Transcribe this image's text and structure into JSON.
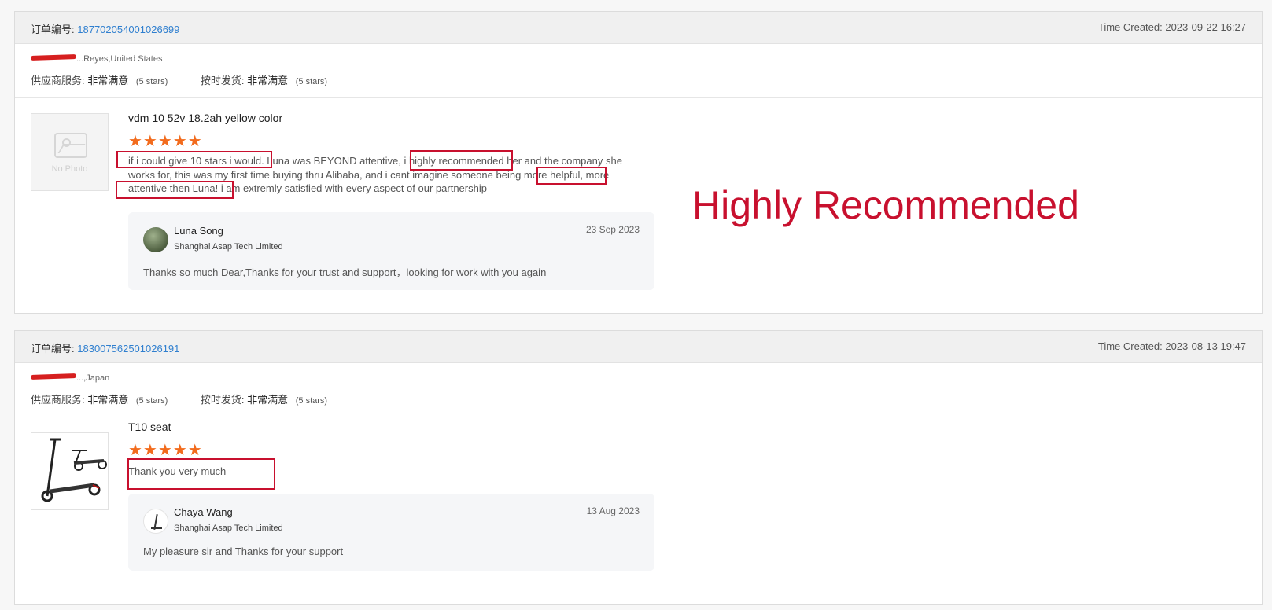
{
  "orders": [
    {
      "order_label": "订单编号:",
      "order_number": "187702054001026699",
      "time_created": "Time Created: 2023-09-22 16:27",
      "location": "...Reyes,United States",
      "supplier_service_label": "供应商服务:",
      "supplier_service_value": "非常满意",
      "supplier_service_stars": "(5 stars)",
      "on_time_label": "按时发货:",
      "on_time_value": "非常满意",
      "on_time_stars": "(5 stars)",
      "no_photo_label": "No Photo",
      "product_title": "vdm 10 52v 18.2ah yellow color",
      "rating": 5,
      "review_text": "if i could give 10 stars i would. Luna was BEYOND  attentive, i highly recommended her and the company she works for, this was my first time buying thru Alibaba, and i cant imagine someone being more helpful, more attentive then Luna! i am extremly satisfied with every aspect of our partnership",
      "reply": {
        "name": "Luna Song",
        "company": "Shanghai Asap Tech Limited",
        "date": "23 Sep 2023",
        "text": "Thanks so much Dear,Thanks for your trust and support，looking for work with you again"
      }
    },
    {
      "order_label": "订单编号:",
      "order_number": "183007562501026191",
      "time_created": "Time Created: 2023-08-13 19:47",
      "location": "...,Japan",
      "supplier_service_label": "供应商服务:",
      "supplier_service_value": "非常满意",
      "supplier_service_stars": "(5 stars)",
      "on_time_label": "按时发货:",
      "on_time_value": "非常满意",
      "on_time_stars": "(5 stars)",
      "product_title": "T10 seat",
      "rating": 5,
      "review_text": "Thank you very much",
      "reply": {
        "name": "Chaya Wang",
        "company": "Shanghai Asap Tech Limited",
        "date": "13 Aug 2023",
        "text": "My pleasure sir and Thanks for your support"
      }
    }
  ],
  "stars_glyphs": "★★★★★",
  "callout_text": "Highly Recommended",
  "colors": {
    "accent_link": "#2f7fcf",
    "star": "#f26b1d",
    "annotation_red": "#c8102e"
  }
}
